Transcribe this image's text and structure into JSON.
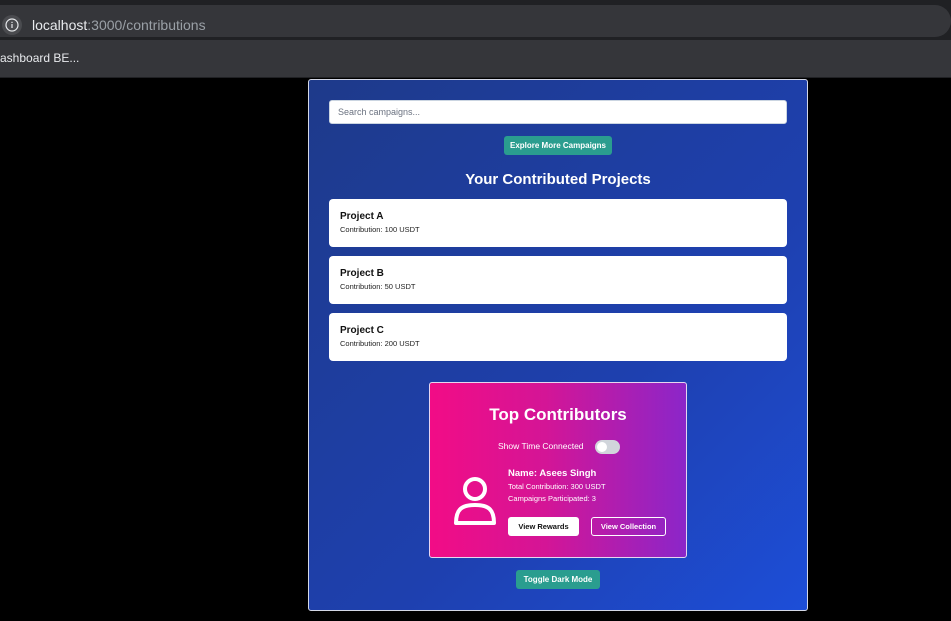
{
  "browser": {
    "url_host": "localhost",
    "url_rest": ":3000/contributions",
    "bookmark_label": "ashboard BE..."
  },
  "search": {
    "placeholder": "Search campaigns..."
  },
  "explore_button": "Explore More Campaigns",
  "section_title": "Your Contributed Projects",
  "projects": [
    {
      "name": "Project A",
      "contribution": "Contribution: 100 USDT"
    },
    {
      "name": "Project B",
      "contribution": "Contribution: 50 USDT"
    },
    {
      "name": "Project C",
      "contribution": "Contribution: 200 USDT"
    }
  ],
  "top_contributors": {
    "title": "Top Contributors",
    "toggle_label": "Show Time Connected",
    "toggle_on": false,
    "contributor": {
      "name": "Name: Asees Singh",
      "total": "Total Contribution: 300 USDT",
      "campaigns": "Campaigns Participated: 3"
    },
    "rewards_button": "View Rewards",
    "collection_button": "View Collection"
  },
  "dark_mode_button": "Toggle Dark Mode",
  "colors": {
    "card_bg": "#1e40af",
    "teal_button": "#2a9d8f",
    "gradient_start": "#f20c86",
    "gradient_end": "#8b26c9"
  }
}
